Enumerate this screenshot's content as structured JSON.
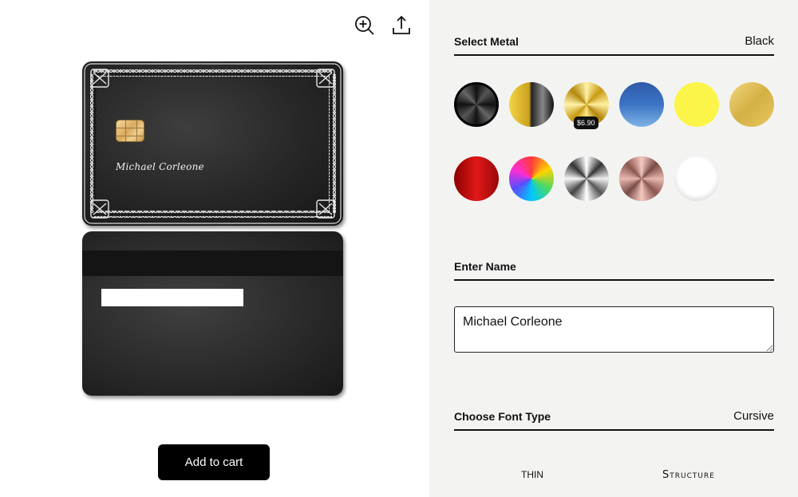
{
  "toolbar": {
    "zoom_icon": "zoom-in-icon",
    "share_icon": "share-icon"
  },
  "card": {
    "name": "Michael Corleone",
    "back_stripe": "magnetic-stripe",
    "signature_panel": ""
  },
  "cart": {
    "add_to_cart_label": "Add to cart"
  },
  "metal": {
    "label": "Select Metal",
    "selected": "Black",
    "swatches": [
      {
        "id": "black",
        "style": "black-brushed"
      },
      {
        "id": "gold-black",
        "style": "gold-black-split"
      },
      {
        "id": "gold-premium",
        "style": "gold-brushed",
        "price": "$6.90"
      },
      {
        "id": "blue",
        "style": "blue"
      },
      {
        "id": "yellow",
        "style": "yellow"
      },
      {
        "id": "gold",
        "style": "gold"
      },
      {
        "id": "red",
        "style": "red"
      },
      {
        "id": "rainbow",
        "style": "rainbow"
      },
      {
        "id": "silver",
        "style": "silver-brushed"
      },
      {
        "id": "rose-gold",
        "style": "rose-gold-brushed"
      },
      {
        "id": "white",
        "style": "white"
      }
    ]
  },
  "name_entry": {
    "label": "Enter Name",
    "value": "Michael Corleone"
  },
  "font_type": {
    "label": "Choose Font Type",
    "selected": "Cursive",
    "options": [
      "THIN",
      "Structure"
    ]
  }
}
